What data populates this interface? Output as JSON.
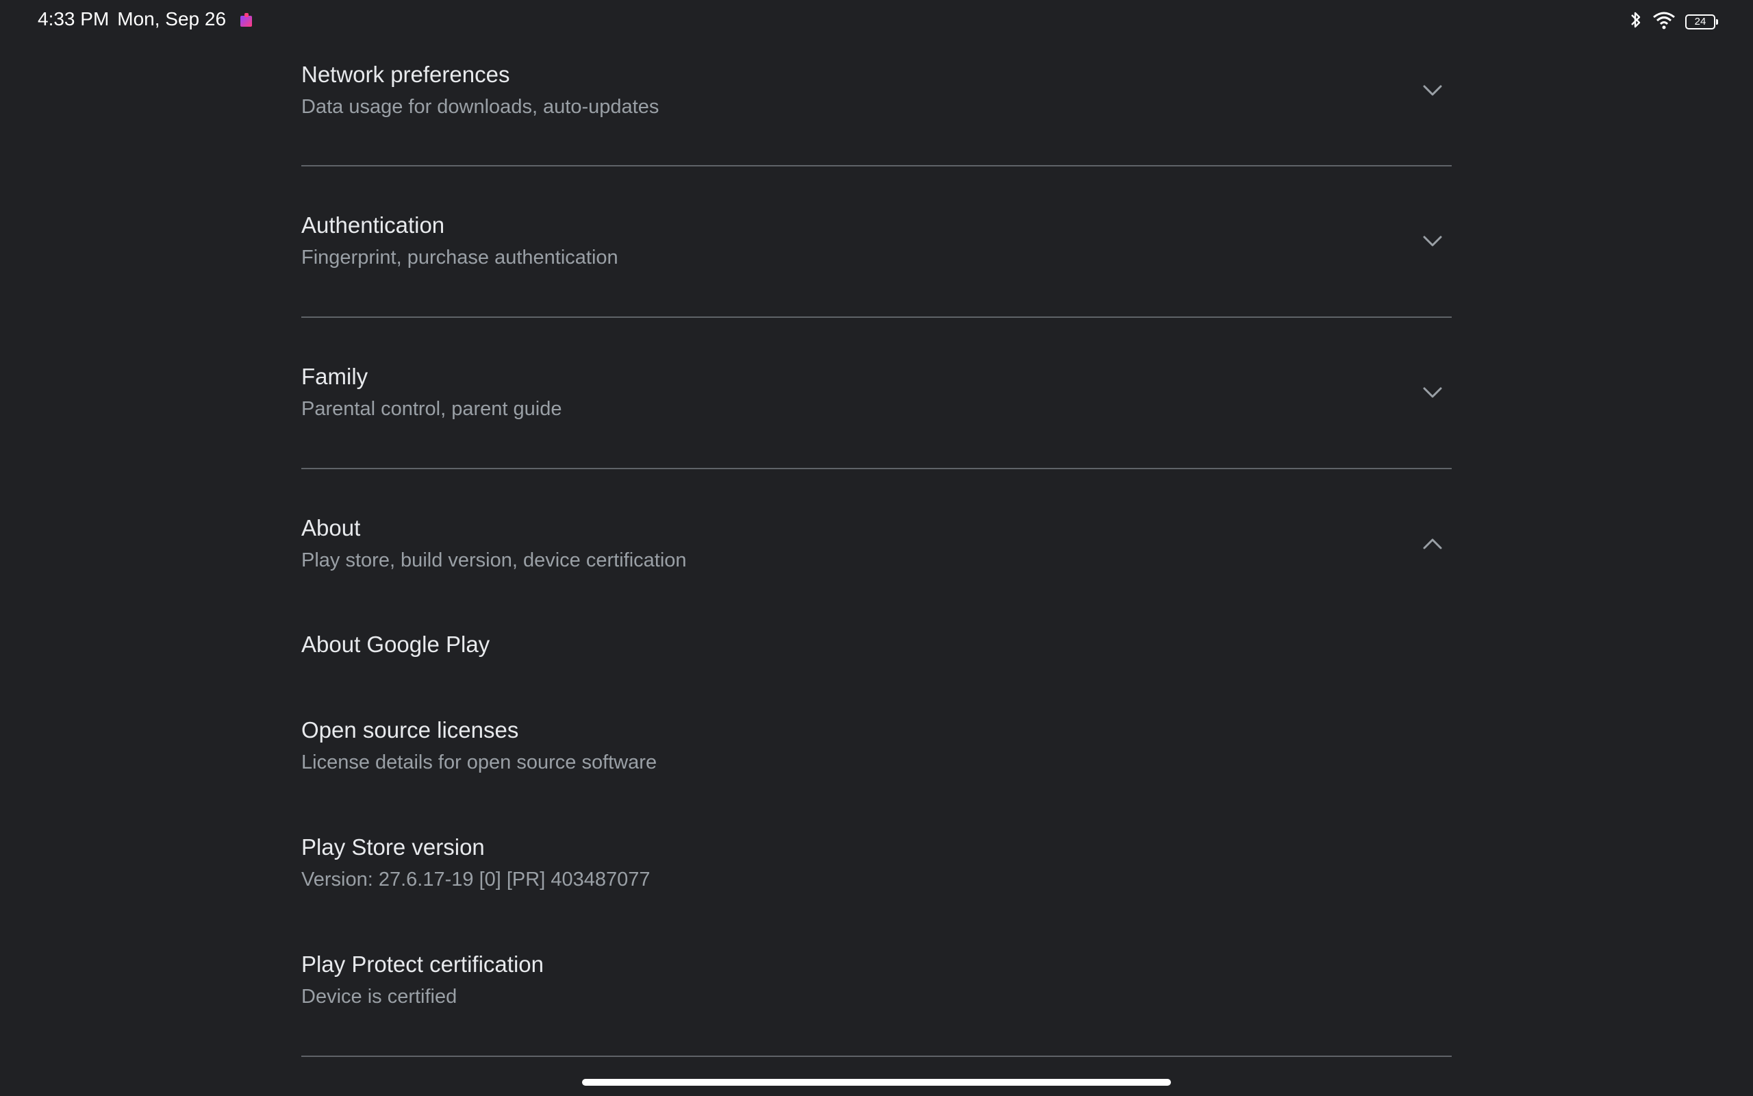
{
  "status_bar": {
    "time": "4:33 PM",
    "date": "Mon, Sep 26",
    "battery": "24",
    "icons": [
      "notification-app-icon",
      "bluetooth-icon",
      "wifi-icon",
      "battery-icon"
    ]
  },
  "sections": {
    "network": {
      "title": "Network preferences",
      "subtitle": "Data usage for downloads, auto-updates",
      "icon": "chevron-down-icon"
    },
    "authentication": {
      "title": "Authentication",
      "subtitle": "Fingerprint, purchase authentication",
      "icon": "chevron-down-icon"
    },
    "family": {
      "title": "Family",
      "subtitle": "Parental control, parent guide",
      "icon": "chevron-down-icon"
    },
    "about": {
      "title": "About",
      "subtitle": "Play store, build version, device certification",
      "icon": "chevron-up-icon"
    }
  },
  "about_items": {
    "about_google_play": {
      "title": "About Google Play"
    },
    "open_source": {
      "title": "Open source licenses",
      "subtitle": "License details for open source software"
    },
    "version": {
      "title": "Play Store version",
      "subtitle": "Version: 27.6.17-19 [0] [PR] 403487077"
    },
    "play_protect": {
      "title": "Play Protect certification",
      "subtitle": "Device is certified"
    }
  },
  "colors": {
    "background": "#202124",
    "primary_text": "#e8eaed",
    "secondary_text": "#9aa0a6",
    "divider": "#5f6368"
  }
}
